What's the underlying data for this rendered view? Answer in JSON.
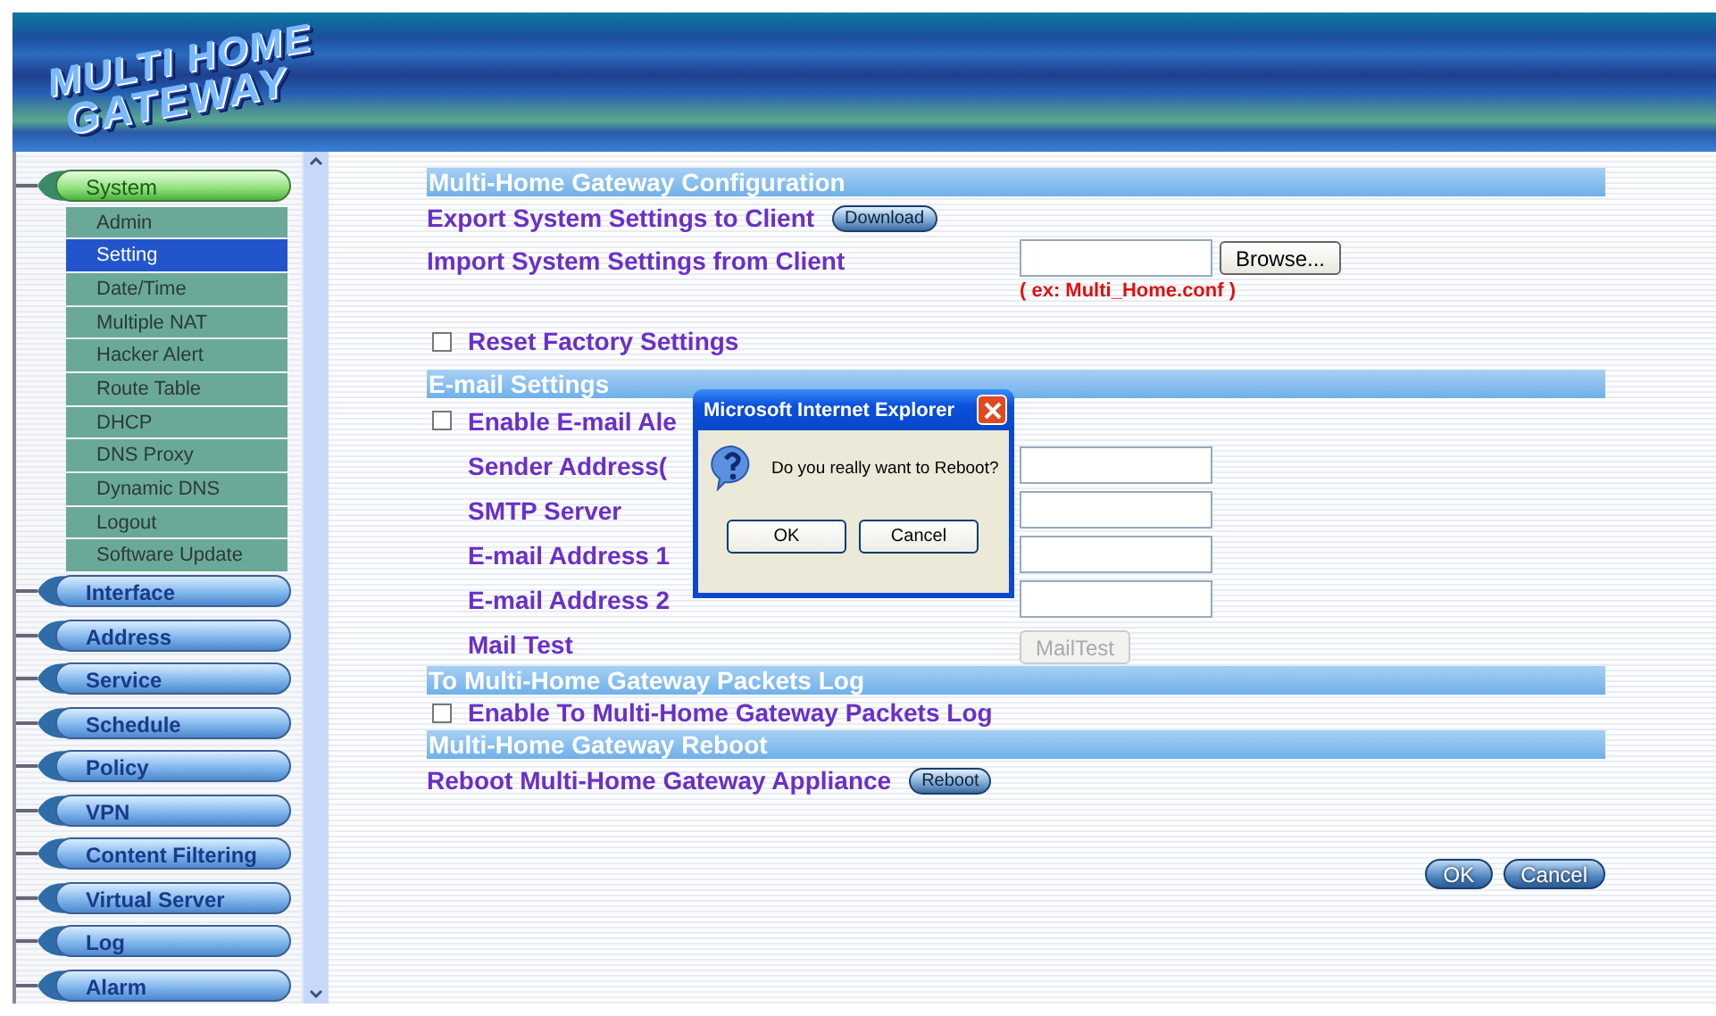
{
  "logo": {
    "lines": [
      "MULTI HOME",
      "GATEWAY"
    ]
  },
  "sidebar": {
    "items": [
      {
        "label": "System",
        "expanded": true,
        "children": [
          {
            "label": "Admin",
            "selected": false
          },
          {
            "label": "Setting",
            "selected": true
          },
          {
            "label": "Date/Time",
            "selected": false
          },
          {
            "label": "Multiple NAT",
            "selected": false
          },
          {
            "label": "Hacker Alert",
            "selected": false
          },
          {
            "label": "Route Table",
            "selected": false
          },
          {
            "label": "DHCP",
            "selected": false
          },
          {
            "label": "DNS Proxy",
            "selected": false
          },
          {
            "label": "Dynamic DNS",
            "selected": false
          },
          {
            "label": "Logout",
            "selected": false
          },
          {
            "label": "Software Update",
            "selected": false
          }
        ]
      },
      {
        "label": "Interface",
        "expanded": false
      },
      {
        "label": "Address",
        "expanded": false
      },
      {
        "label": "Service",
        "expanded": false
      },
      {
        "label": "Schedule",
        "expanded": false
      },
      {
        "label": "Policy",
        "expanded": false
      },
      {
        "label": "VPN",
        "expanded": false
      },
      {
        "label": "Content Filtering",
        "expanded": false
      },
      {
        "label": "Virtual Server",
        "expanded": false
      },
      {
        "label": "Log",
        "expanded": false
      },
      {
        "label": "Alarm",
        "expanded": false
      }
    ]
  },
  "sections": [
    {
      "title": "Multi-Home Gateway Configuration",
      "rows": [
        {
          "kind": "action",
          "label": "Export System Settings to Client",
          "button": "Download"
        },
        {
          "kind": "file",
          "label": "Import System Settings from Client",
          "button": "Browse...",
          "hint": "( ex: Multi_Home.conf )"
        },
        {
          "kind": "checkbox",
          "label": "Reset Factory Settings",
          "checked": false
        }
      ]
    },
    {
      "title": "E-mail Settings",
      "rows": [
        {
          "kind": "checkbox",
          "label": "Enable E-mail Ale",
          "checked": false
        },
        {
          "kind": "field",
          "label": "Sender Address("
        },
        {
          "kind": "field",
          "label": "SMTP Server"
        },
        {
          "kind": "field",
          "label": "E-mail Address 1"
        },
        {
          "kind": "field",
          "label": "E-mail Address 2"
        },
        {
          "kind": "test",
          "label": "Mail Test",
          "button": "MailTest",
          "disabled": true
        }
      ]
    },
    {
      "title": "To Multi-Home Gateway Packets Log",
      "rows": [
        {
          "kind": "checkbox",
          "label": "Enable To Multi-Home Gateway Packets Log",
          "checked": false
        }
      ]
    },
    {
      "title": "Multi-Home Gateway Reboot",
      "rows": [
        {
          "kind": "action",
          "label": "Reboot Multi-Home Gateway Appliance",
          "button": "Reboot"
        }
      ]
    }
  ],
  "buttons": [
    "OK",
    "Cancel"
  ],
  "dialog": {
    "title": "Microsoft Internet Explorer",
    "message": "Do you really want to Reboot?",
    "buttons": [
      "OK",
      "Cancel"
    ]
  }
}
